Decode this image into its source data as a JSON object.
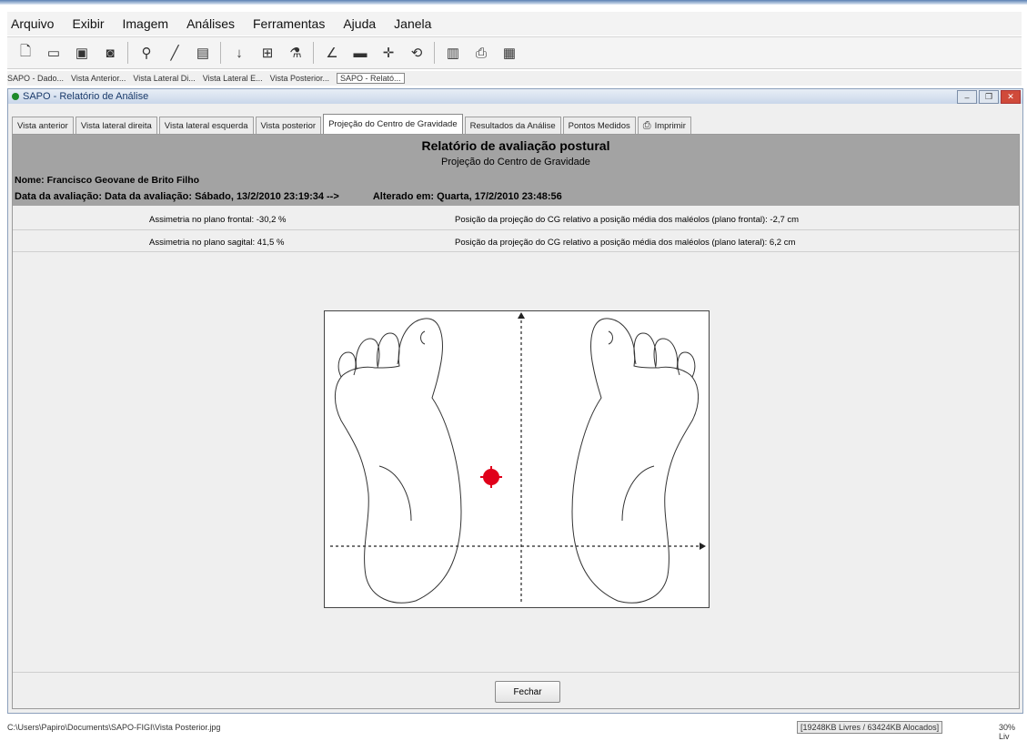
{
  "menu": [
    "Arquivo",
    "Exibir",
    "Imagem",
    "Análises",
    "Ferramentas",
    "Ajuda",
    "Janela"
  ],
  "toolbar_icons": [
    "new-document-icon",
    "open-icon",
    "save-icon",
    "camera-icon",
    "search-icon",
    "pencil-icon",
    "frame-icon",
    "vertical-line-icon",
    "grid-icon",
    "zoom-icon",
    "angle-icon",
    "horizontal-line-icon",
    "cross-icon",
    "rotate-icon",
    "report-icon",
    "print-icon",
    "export-icon"
  ],
  "window_tabs": [
    "SAPO - Dado...",
    "Vista Anterior...",
    "Vista Lateral Di...",
    "Vista Lateral E...",
    "Vista Posterior...",
    "SAPO - Relató..."
  ],
  "window": {
    "title": "SAPO - Relatório de Análise",
    "tabs": [
      "Vista anterior",
      "Vista lateral direita",
      "Vista lateral esquerda",
      "Vista posterior",
      "Projeção do Centro de Gravidade",
      "Resultados da Análise",
      "Pontos Medidos",
      "Imprimir"
    ]
  },
  "report": {
    "title": "Relatório de avaliação postural",
    "subtitle": "Projeção do Centro de Gravidade",
    "name_line": "Nome: Francisco Geovane de Brito Filho",
    "date_line": "Data da avaliação: Data da avaliação: Sábado, 13/2/2010 23:19:34   -->",
    "altered_line": "Alterado em: Quarta, 17/2/2010 23:48:56",
    "asym_frontal": "Assimetria no plano frontal: -30,2 %",
    "asym_sagittal": "Assimetria no plano sagital: 41,5 %",
    "pos_frontal": "Posição da projeção do CG relativo a posição média dos maléolos (plano frontal): -2,7 cm",
    "pos_lateral": "Posição da projeção do CG relativo a posição média dos maléolos (plano lateral): 6,2 cm"
  },
  "close_button": "Fechar",
  "status": {
    "path": "C:\\Users\\Papiro\\Documents\\SAPO-FIGI\\Vista Posterior.jpg",
    "memory": "[19248KB Livres / 63424KB Alocados]",
    "zoom": "30% Liv"
  },
  "colors": {
    "cg_marker": "#e0001a",
    "header_bg": "#a3a3a3"
  }
}
